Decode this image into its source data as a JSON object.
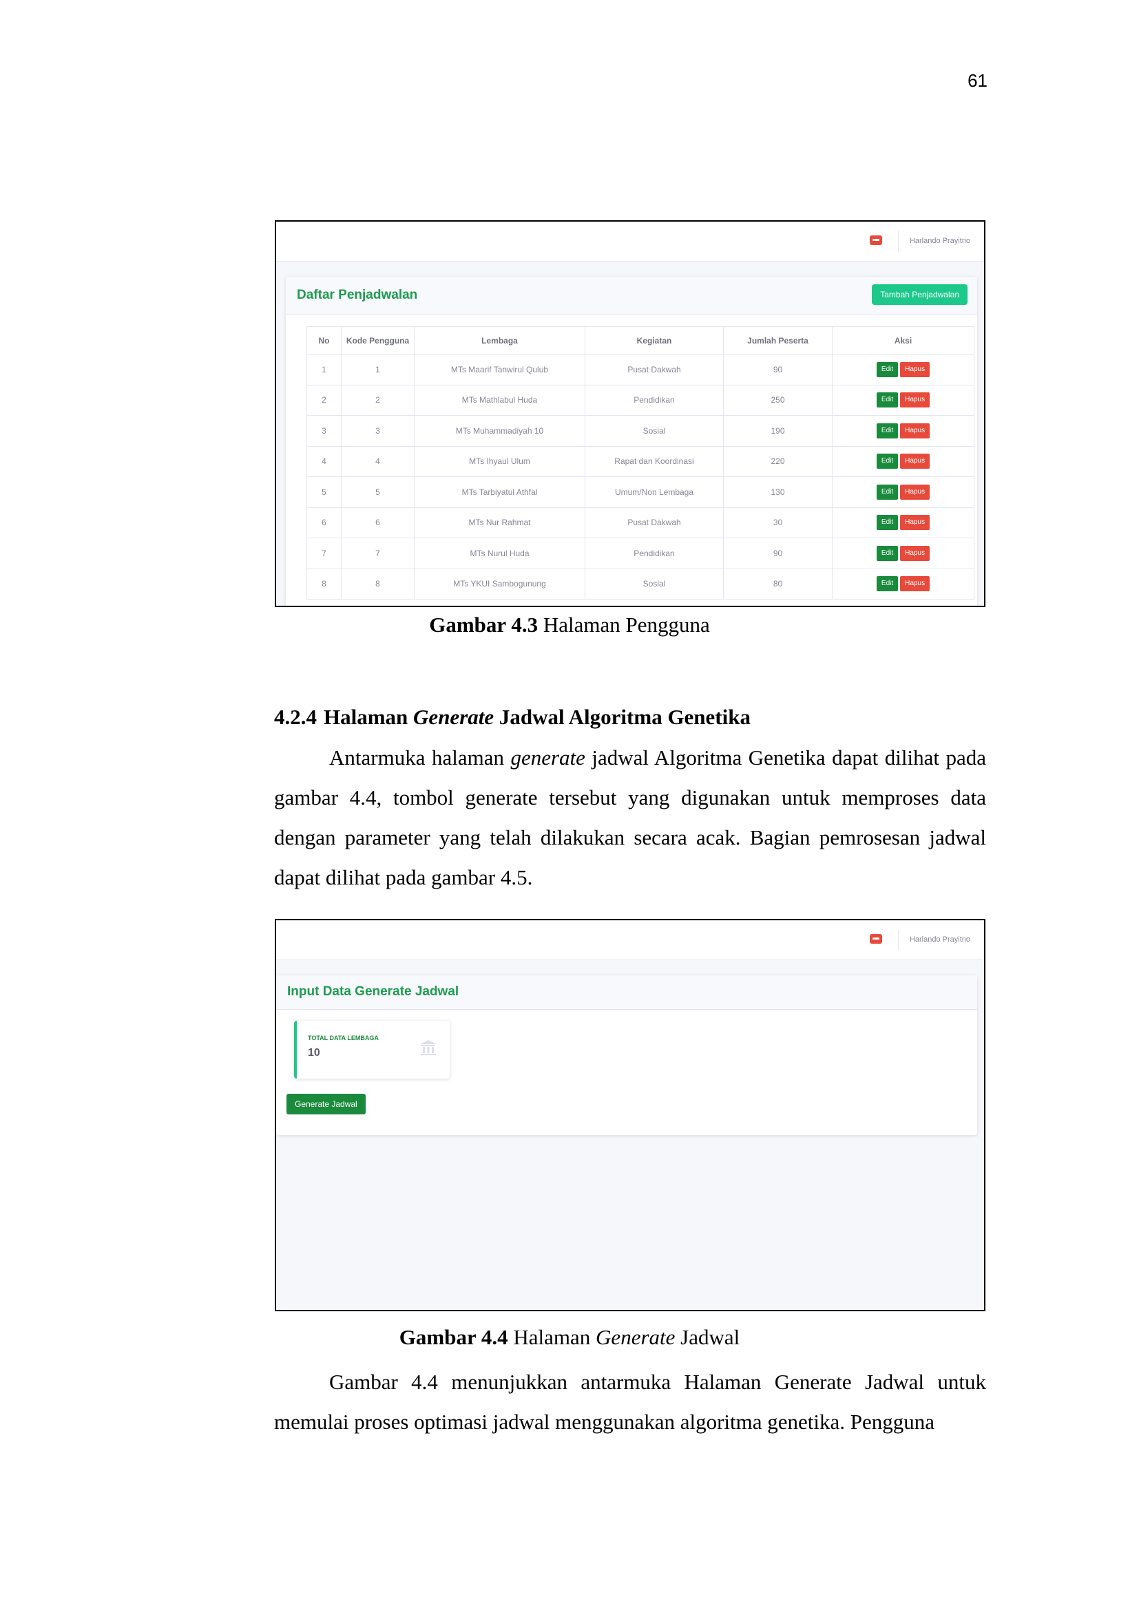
{
  "page_number": "61",
  "figure1": {
    "topbar_user": "Harlando Prayitno",
    "card_title": "Daftar Penjadwalan",
    "add_button": "Tambah Penjadwalan",
    "columns": [
      "No",
      "Kode Pengguna",
      "Lembaga",
      "Kegiatan",
      "Jumlah Peserta",
      "Aksi"
    ],
    "rows": [
      [
        "1",
        "1",
        "MTs Maarif Tanwirul Qulub",
        "Pusat Dakwah",
        "90"
      ],
      [
        "2",
        "2",
        "MTs Mathlabul Huda",
        "Pendidikan",
        "250"
      ],
      [
        "3",
        "3",
        "MTs Muhammadiyah 10",
        "Sosial",
        "190"
      ],
      [
        "4",
        "4",
        "MTs Ihyaul Ulum",
        "Rapat dan Koordinasi",
        "220"
      ],
      [
        "5",
        "5",
        "MTs Tarbiyatul Athfal",
        "Umum/Non Lembaga",
        "130"
      ],
      [
        "6",
        "6",
        "MTs Nur Rahmat",
        "Pusat Dakwah",
        "30"
      ],
      [
        "7",
        "7",
        "MTs Nurul Huda",
        "Pendidikan",
        "90"
      ],
      [
        "8",
        "8",
        "MTs YKUI Sambogunung",
        "Sosial",
        "80"
      ]
    ],
    "edit_label": "Edit",
    "delete_label": "Hapus"
  },
  "caption1": {
    "bold": "Gambar 4.3",
    "rest": " Halaman Pengguna"
  },
  "section": {
    "number": "4.2.4",
    "pre": "Halaman ",
    "italic": "Generate",
    "post": " Jadwal Algoritma Genetika"
  },
  "paragraph1": {
    "p1": "Antarmuka halaman ",
    "italic": "generate",
    "p2": " jadwal Algoritma Genetika dapat dilihat pada gambar 4.4, tombol generate tersebut yang digunakan untuk memproses data dengan parameter yang telah dilakukan secara acak. Bagian pemrosesan jadwal dapat dilihat pada gambar 4.5."
  },
  "figure2": {
    "topbar_user": "Harlando Prayitno",
    "card_title": "Input Data Generate Jadwal",
    "stat_label": "TOTAL DATA LEMBAGA",
    "stat_value": "10",
    "generate_button": "Generate Jadwal"
  },
  "caption2": {
    "bold": "Gambar 4.4",
    "pre": " Halaman ",
    "italic": "Generate",
    "post": " Jadwal"
  },
  "paragraph2": {
    "text": "Gambar 4.4 menunjukkan antarmuka Halaman Generate Jadwal untuk memulai proses optimasi jadwal menggunakan algoritma genetika. Pengguna"
  },
  "colors": {
    "accent_green": "#1e9b4f",
    "add_button": "#1cc88a",
    "delete_red": "#e74a3b"
  },
  "icons": [
    "bell-icon",
    "institution-icon"
  ]
}
